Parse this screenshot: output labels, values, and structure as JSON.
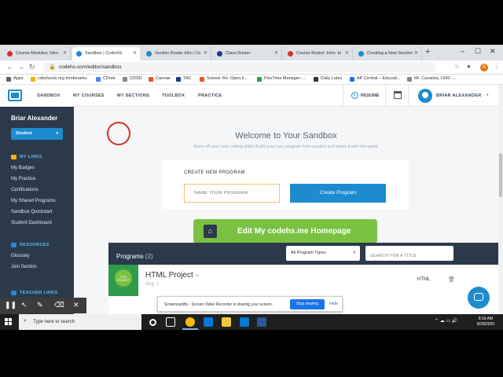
{
  "browser": {
    "tabs": [
      {
        "label": "Course Modules: Intro",
        "fav_color": "#d93025"
      },
      {
        "label": "Sandbox | CodeHS",
        "fav_color": "#1d8ccf"
      },
      {
        "label": "Section Roster Info | Co",
        "fav_color": "#1d8ccf"
      },
      {
        "label": "Class Roster",
        "fav_color": "#1e3a8a"
      },
      {
        "label": "Course Roster: Intro. to",
        "fav_color": "#d93025"
      },
      {
        "label": "Creating a New Section",
        "fav_color": "#1d8ccf"
      }
    ],
    "new_tab_glyph": "+",
    "window_controls": [
      "–",
      "☐",
      "✕"
    ],
    "url": "codehs.com/editor/sandbox",
    "profile_initial": "B",
    "bookmarks": [
      {
        "label": "Apps",
        "color": "#5f6368"
      },
      {
        "label": "cdschools.org bookmarks",
        "color": "#f4b400"
      },
      {
        "label": "CDnet",
        "color": "#4285f4"
      },
      {
        "label": "CDSD",
        "color": "#888888"
      },
      {
        "label": "Canvas",
        "color": "#e4572e"
      },
      {
        "label": "TAC",
        "color": "#1e3a8a"
      },
      {
        "label": "Solved: Re: Open li...",
        "color": "#e4572e"
      },
      {
        "label": "FlexTime Manager-...",
        "color": "#2e9c4b"
      },
      {
        "label": "Daily Lates",
        "color": "#333333"
      },
      {
        "label": "AP Central – Educati...",
        "color": "#1a73e8"
      },
      {
        "label": "Mr. Cavaiola, LIHS -...",
        "color": "#888888"
      }
    ]
  },
  "header": {
    "nav": [
      "SANDBOX",
      "MY COURSES",
      "MY SECTIONS",
      "TOOLBOX",
      "PRACTICE"
    ],
    "resume": "RESUME",
    "user_name": "BRIAR ALEXANDER"
  },
  "sidebar": {
    "name": "Briar Alexander",
    "role": "Student",
    "my_links_title": "MY LINKS",
    "my_links": [
      "My Badges",
      "My Practice",
      "Certifications",
      "My Shared Programs",
      "Sandbox Quickstart",
      "Student Dashboard"
    ],
    "resources_title": "RESOURCES",
    "resources": [
      "Glossary",
      "Join Section"
    ],
    "teacher_links_title": "TEACHER LINKS"
  },
  "main": {
    "welcome": "Welcome to Your Sandbox",
    "subtitle": "Show off your new coding skills! Build your own program from scratch and share it with the world.",
    "create_label": "CREATE NEW PROGRAM",
    "name_placeholder": "NAME YOUR PROGRAM",
    "create_button": "Create Program",
    "edit_homepage": "Edit My codehs.me Homepage",
    "programs_title": "Programs",
    "programs_count": "(2)",
    "program_type_select": "All Program Types",
    "search_placeholder": "SEARCH FOR A TITLE",
    "programs": [
      {
        "name": "HTML Project",
        "date": "Aug. 1",
        "type": "HTML",
        "thumb_text": "HTML PROJECT"
      }
    ]
  },
  "screencastify": {
    "message": "Screencastify - Screen Video Recorder is sharing your screen.",
    "stop": "Stop sharing",
    "hide": "Hide"
  },
  "taskbar": {
    "search_placeholder": "Type here to search",
    "time": "8:16 AM",
    "date": "8/28/2020"
  },
  "colors": {
    "brand_blue": "#1d8ccf",
    "sidebar_bg": "#2b3a4a",
    "green": "#7ac142"
  }
}
